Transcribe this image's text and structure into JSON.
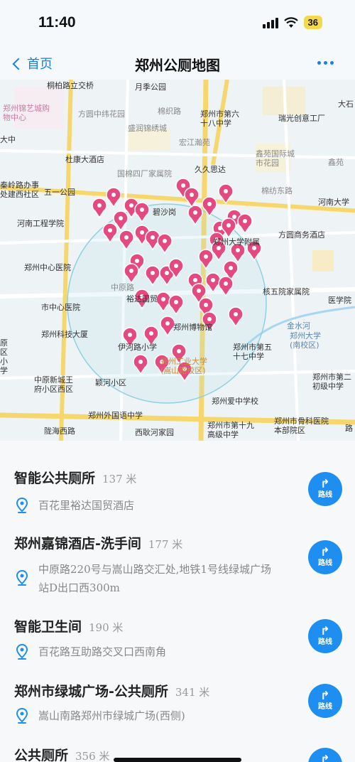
{
  "status": {
    "time": "11:40",
    "battery": "36"
  },
  "nav": {
    "back_label": "首页",
    "title": "郑州公厕地图",
    "more_icon": "more-dots-icon"
  },
  "map": {
    "labels": [
      "桐柏路立交桥",
      "月季公园",
      "郑州锦艺城购物中心",
      "方圆中纬花园",
      "棉织路",
      "郑州市第六十八中学",
      "瑞光创意工厂",
      "大石",
      "盛润锦绣城",
      "宏江瀚苑",
      "大中",
      "杜康大酒店",
      "鑫苑国际城市花园",
      "鑫苑",
      "秦岭路办事处建西社区",
      "久久思达",
      "国棉四厂家属院",
      "五一公园",
      "碧沙岗",
      "棉纺东路",
      "河南大学",
      "河南工程学院",
      "方圆商务酒店",
      "郑州中心医院",
      "市中心医院",
      "中原路",
      "裕达国贸",
      "郑州大学附属",
      "核五院家属院",
      "医学院",
      "郑州科技大厦",
      "郑州博物馆",
      "金水河",
      "郑州大学(南校区)",
      "伊河路小学",
      "郑州市第五十七中学",
      "原区小学",
      "中原新城王府小区西区",
      "颖河小区",
      "郑州工业大学(嵩山路校区)",
      "郑州市第二初级中学",
      "郑州爱中学校",
      "郑州外国语中学",
      "郑州市骨科医院本部院区",
      "陇海西路",
      "西耿河家园",
      "郑州市第十九高级中学",
      "路"
    ]
  },
  "results": [
    {
      "name": "智能公共厕所",
      "distance": "137 米",
      "address": "百花里裕达国贸酒店",
      "route_label": "路线"
    },
    {
      "name": "郑州嘉锦酒店-洗手间",
      "distance": "177 米",
      "address": "中原路220号与嵩山路交汇处,地铁1号线绿城广场站D出口西300m",
      "route_label": "路线"
    },
    {
      "name": "智能卫生间",
      "distance": "190 米",
      "address": "百花路互助路交叉口西南角",
      "route_label": "路线"
    },
    {
      "name": "郑州市绿城广场-公共厕所",
      "distance": "341 米",
      "address": "嵩山南路郑州市绿城广场(西侧)",
      "route_label": "路线"
    },
    {
      "name": "公共厕所",
      "distance": "356 米",
      "address": "",
      "route_label": "路线"
    }
  ],
  "colors": {
    "accent": "#1a7ee8",
    "pin": "#e44a7f",
    "route_button": "#1e8ff0",
    "map_road": "#f5d76e"
  }
}
